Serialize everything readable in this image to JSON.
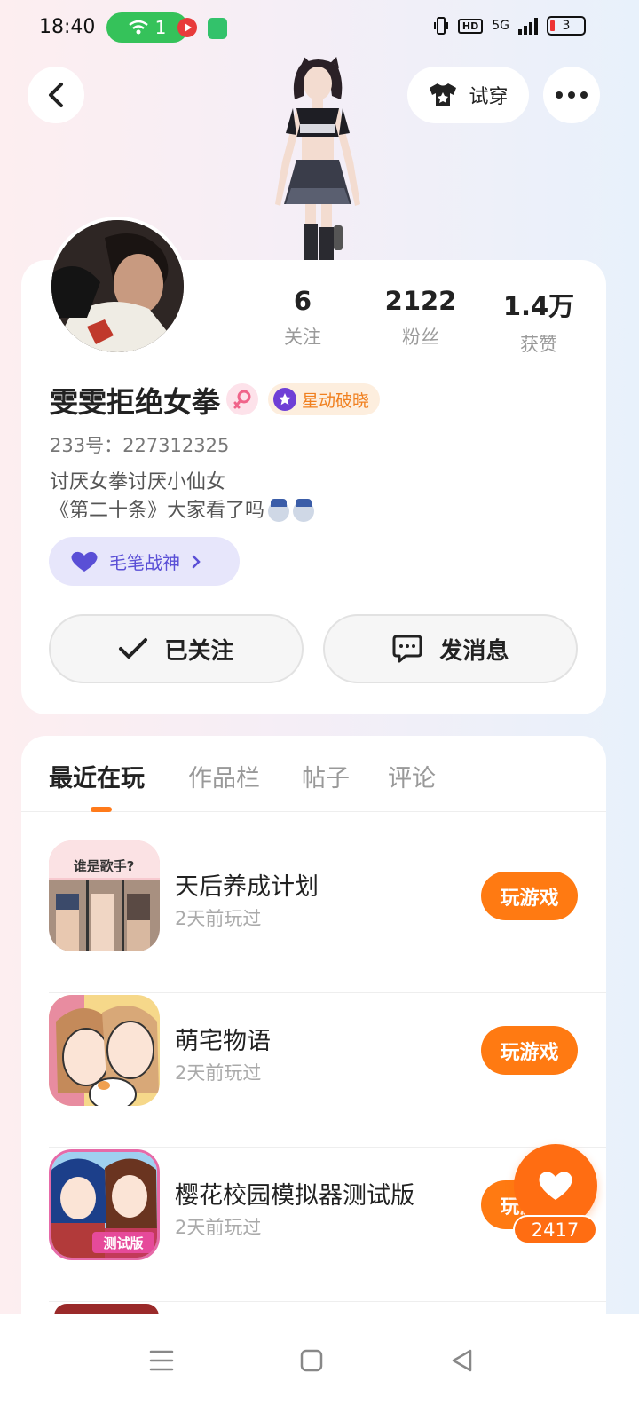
{
  "status_bar": {
    "time": "18:40",
    "wifi_count": "1",
    "network": "5G",
    "hd": "HD",
    "battery": "3"
  },
  "header": {
    "back_icon": "chevron-left-icon",
    "try_on_label": "试穿",
    "more_icon": "more-dots-icon"
  },
  "profile": {
    "stats": [
      {
        "value": "6",
        "label": "关注"
      },
      {
        "value": "2122",
        "label": "粉丝"
      },
      {
        "value": "1.4万",
        "label": "获赞"
      }
    ],
    "username": "雯雯拒绝女拳",
    "gender": "female-icon",
    "rank_badge": "星动破晓",
    "uid": "233号：227312325",
    "bio_line1": "讨厌女拳讨厌小仙女",
    "bio_line2": "《第二十条》大家看了吗",
    "title_pill": "毛笔战神",
    "follow_label": "已关注",
    "message_label": "发消息"
  },
  "tabs": [
    {
      "label": "最近在玩",
      "active": true
    },
    {
      "label": "作品栏",
      "active": false
    },
    {
      "label": "帖子",
      "active": false
    },
    {
      "label": "评论",
      "active": false
    }
  ],
  "games": [
    {
      "name": "天后养成计划",
      "time": "2天前玩过",
      "button": "玩游戏",
      "icon_text": "谁是歌手?"
    },
    {
      "name": "萌宅物语",
      "time": "2天前玩过",
      "button": "玩游戏"
    },
    {
      "name": "樱花校园模拟器测试版",
      "time": "2天前玩过",
      "button": "玩游戏",
      "icon_text": "测试版"
    }
  ],
  "like": {
    "count": "2417"
  },
  "colors": {
    "accent": "#ff7a12",
    "badge_text": "#f08020",
    "pill_text": "#5a4fd6"
  }
}
